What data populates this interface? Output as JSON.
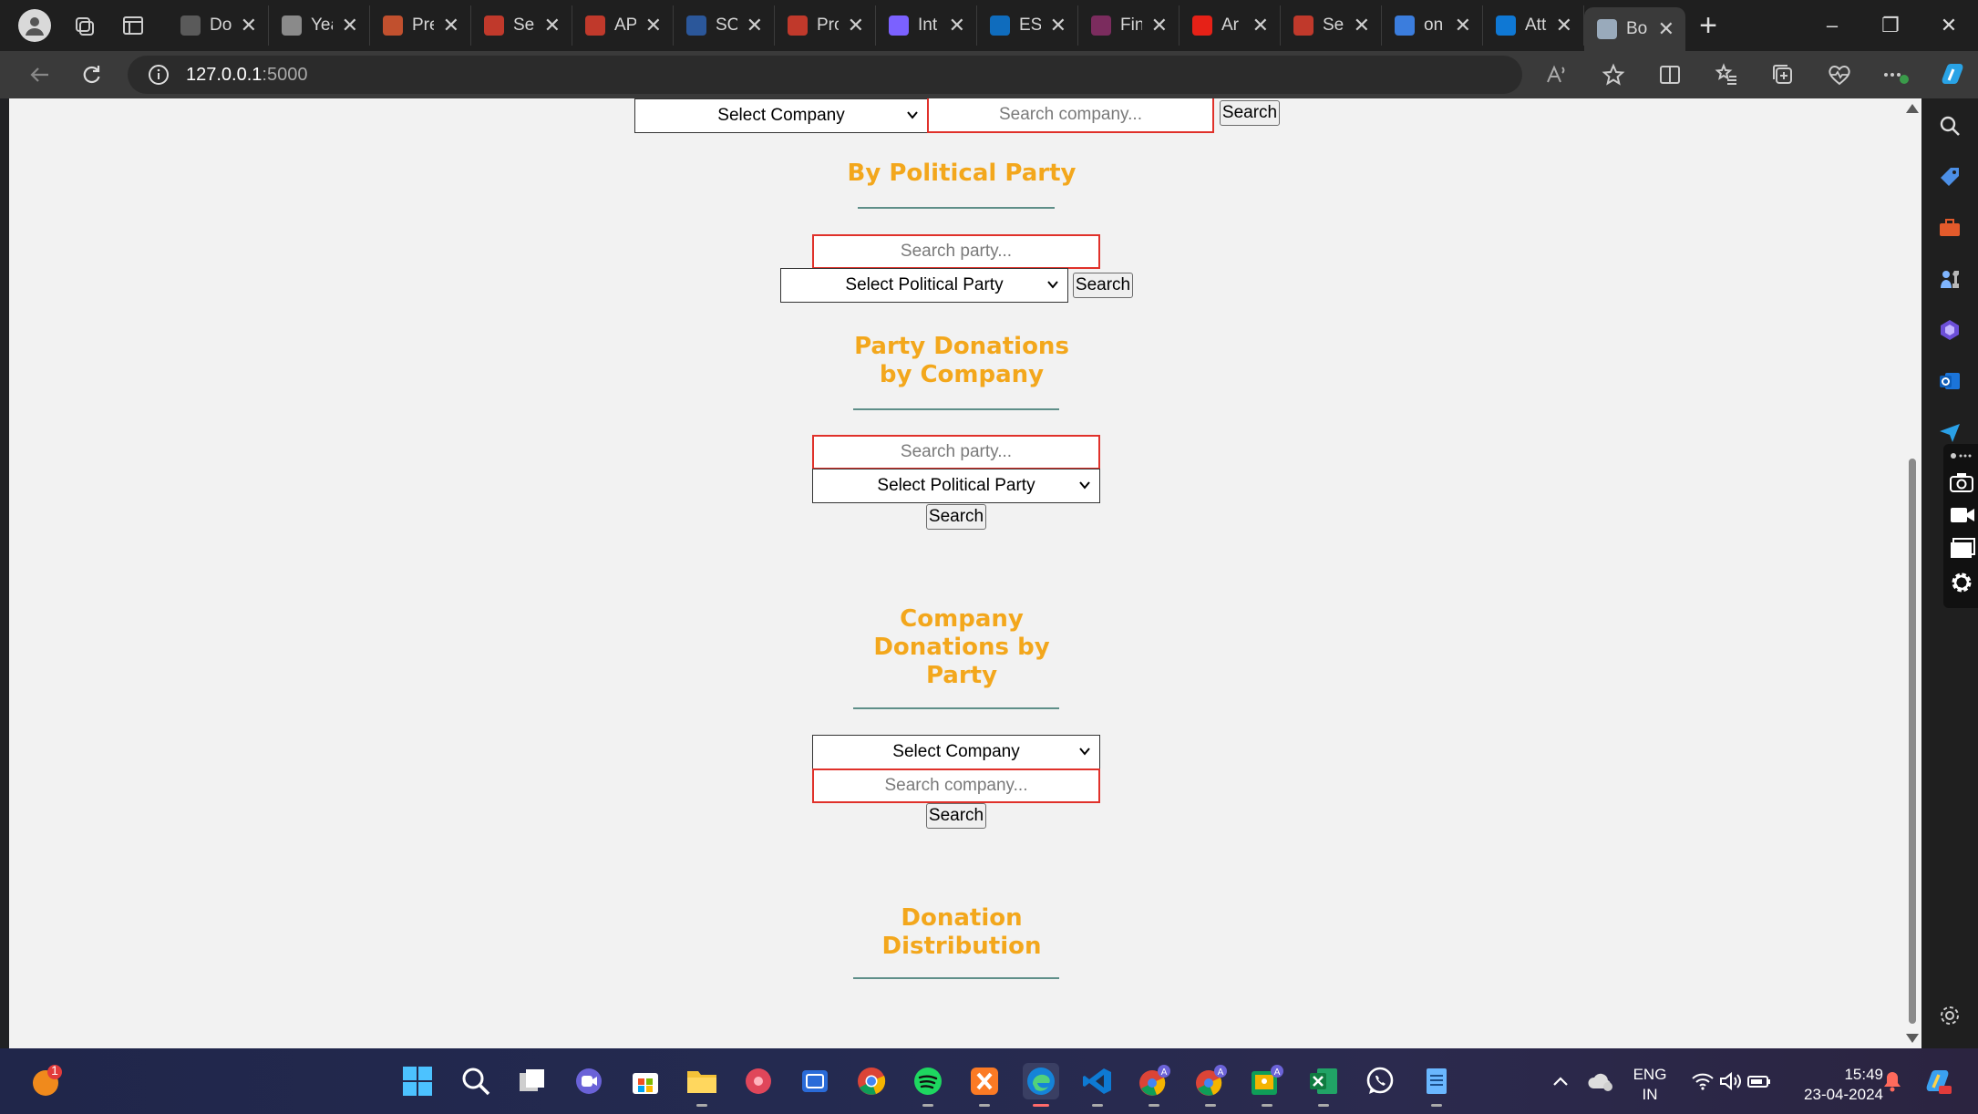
{
  "browser": {
    "tabs": [
      {
        "title": "Do",
        "favicon": "terminal-icon",
        "color": "#5a5a5a"
      },
      {
        "title": "Yea",
        "favicon": "document-icon",
        "color": "#8a8a8a"
      },
      {
        "title": "Pre",
        "favicon": "powerpoint-icon",
        "color": "#c1502e"
      },
      {
        "title": "Se",
        "favicon": "pdf-icon",
        "color": "#c0392b"
      },
      {
        "title": "AP",
        "favicon": "pdf-icon",
        "color": "#c0392b"
      },
      {
        "title": "SO",
        "favicon": "word-icon",
        "color": "#2b579a"
      },
      {
        "title": "Pro",
        "favicon": "pdf-icon",
        "color": "#c0392b"
      },
      {
        "title": "Int",
        "favicon": "copilot-icon",
        "color": "#7b61ff"
      },
      {
        "title": "ES",
        "favicon": "cloud-icon",
        "color": "#0f6cbd"
      },
      {
        "title": "Fin",
        "favicon": "powerapps-icon",
        "color": "#7b2c5e"
      },
      {
        "title": "Ar",
        "favicon": "youtube-icon",
        "color": "#e62117"
      },
      {
        "title": "Se",
        "favicon": "pdf-icon",
        "color": "#c0392b"
      },
      {
        "title": "on",
        "favicon": "search-icon",
        "color": "#3b7ddd"
      },
      {
        "title": "Att",
        "favicon": "onedrive-icon",
        "color": "#0f78d4"
      },
      {
        "title": "Bo",
        "favicon": "window-icon",
        "color": "#9ab",
        "active": true
      }
    ],
    "url_host": "127.0.0.1",
    "url_port": ":5000"
  },
  "page": {
    "company_select_top": "Select Company",
    "company_search_top_placeholder": "Search company...",
    "search_btn_top": "Search",
    "section_party": {
      "title": "By Political Party",
      "search_placeholder": "Search party...",
      "select_label": "Select Political Party",
      "search_btn": "Search"
    },
    "section_party_donations": {
      "title_line1": "Party Donations",
      "title_line2": "by Company",
      "search_placeholder": "Search party...",
      "select_label": "Select Political Party",
      "search_btn": "Search"
    },
    "section_company_donations": {
      "title_line1": "Company",
      "title_line2": "Donations by",
      "title_line3": "Party",
      "select_label": "Select Company",
      "search_placeholder": "Search company...",
      "search_btn": "Search"
    },
    "section_distribution": {
      "title_line1": "Donation",
      "title_line2": "Distribution"
    }
  },
  "taskbar": {
    "notification_badge": "1",
    "lang_line1": "ENG",
    "lang_line2": "IN",
    "time": "15:49",
    "date": "23-04-2024"
  },
  "colors": {
    "heading": "#f3a71c",
    "input_border": "#e0312a",
    "rule": "#5f8f89"
  }
}
